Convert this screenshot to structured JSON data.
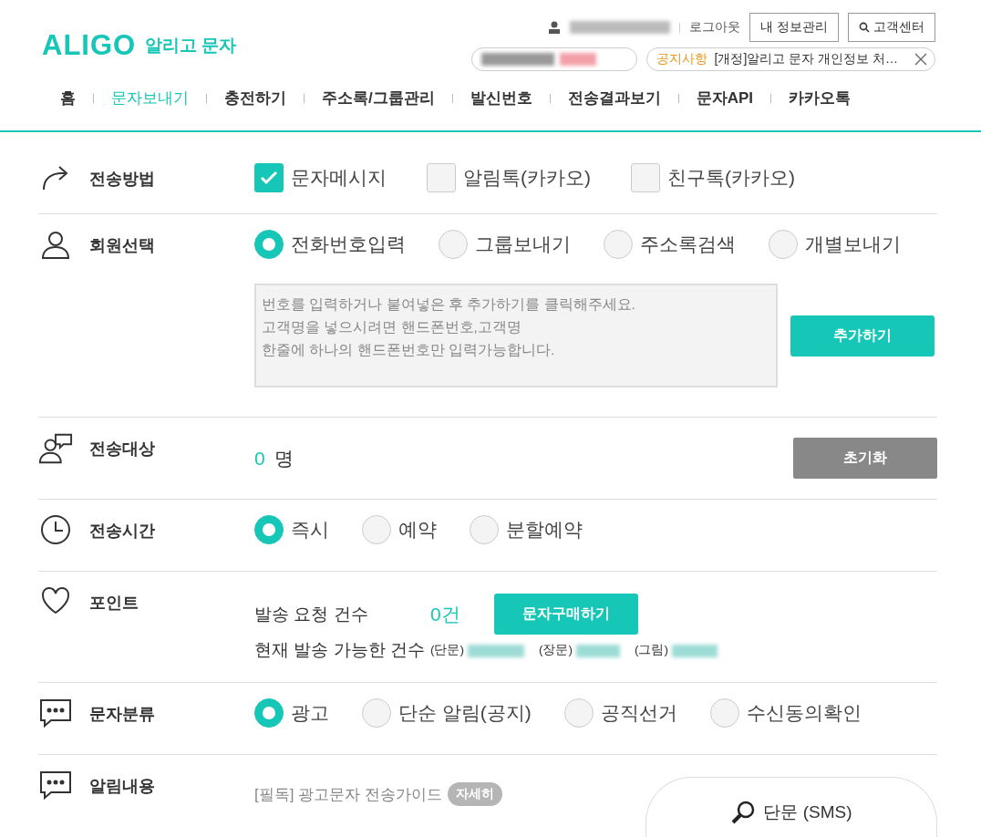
{
  "header": {
    "logo": "ALIGO",
    "subtitle": "알리고 문자",
    "logout": "로그아웃",
    "buttons": [
      {
        "label": "내 정보관리",
        "kind": "plain"
      },
      {
        "label": "고객센터",
        "kind": "search"
      }
    ],
    "notice": {
      "tag": "공지사항",
      "text": "[개정]알리고 문자 개인정보 처…"
    }
  },
  "nav": [
    {
      "label": "홈",
      "selected": false
    },
    {
      "label": "문자보내기",
      "selected": true
    },
    {
      "label": "충전하기",
      "selected": false
    },
    {
      "label": "주소록/그룹관리",
      "selected": false
    },
    {
      "label": "발신번호",
      "selected": false
    },
    {
      "label": "전송결과보기",
      "selected": false
    },
    {
      "label": "문자API",
      "selected": false
    },
    {
      "label": "카카오톡",
      "selected": false
    }
  ],
  "sections": [
    {
      "kind": "checkboxes",
      "label": "전송방법",
      "options": [
        {
          "label": "문자메시지",
          "checked": true
        },
        {
          "label": "알림톡(카카오)",
          "checked": false
        },
        {
          "label": "친구톡(카카오)",
          "checked": false
        }
      ]
    },
    {
      "kind": "radios",
      "label": "회원선택",
      "options": [
        {
          "label": "전화번호입력",
          "selected": true
        },
        {
          "label": "그룹보내기",
          "selected": false
        },
        {
          "label": "주소록검색",
          "selected": false
        },
        {
          "label": "개별보내기",
          "selected": false
        }
      ],
      "input": {
        "placeholder": "번호를 입력하거나 붙여넣은 후 추가하기를 클릭해주세요.\n고객명을 넣으시려면 핸드폰번호,고객명\n한줄에 하나의 핸드폰번호만 입력가능합니다.",
        "button": "추가하기"
      }
    },
    {
      "kind": "recipients",
      "label": "전송대상",
      "count": "0",
      "unit": "명",
      "button": "초기화"
    },
    {
      "kind": "radios",
      "label": "전송시간",
      "options": [
        {
          "label": "즉시",
          "selected": true
        },
        {
          "label": "예약",
          "selected": false
        },
        {
          "label": "분할예약",
          "selected": false
        }
      ]
    },
    {
      "kind": "points",
      "label": "포인트",
      "request_label": "발송 요청 건수",
      "request_count": "0건",
      "button": "문자구매하기",
      "available_label": "현재 발송 가능한 건수",
      "available": [
        "(단문)",
        "(장문)",
        "(그림)"
      ]
    },
    {
      "kind": "radios",
      "label": "문자분류",
      "options": [
        {
          "label": "광고",
          "selected": true
        },
        {
          "label": "단순 알림(공지)",
          "selected": false
        },
        {
          "label": "공직선거",
          "selected": false
        },
        {
          "label": "수신동의확인",
          "selected": false
        }
      ]
    },
    {
      "kind": "guide",
      "label": "알림내용",
      "guide": "[필독] 광고문자 전송가이드",
      "badge": "자세히",
      "tab": "단문 (SMS)"
    }
  ]
}
